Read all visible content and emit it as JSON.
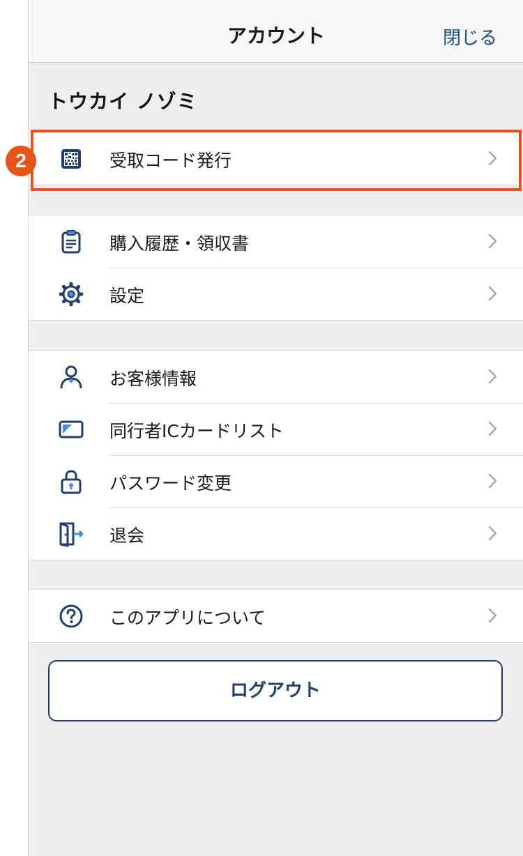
{
  "header": {
    "title": "アカウント",
    "close_label": "閉じる"
  },
  "user": {
    "name": "トウカイ ノゾミ"
  },
  "step_badge": "2",
  "groups": [
    {
      "items": [
        {
          "label": "受取コード発行",
          "icon": "qr-code-icon"
        }
      ]
    },
    {
      "items": [
        {
          "label": "購入履歴・領収書",
          "icon": "clipboard-icon"
        },
        {
          "label": "設定",
          "icon": "gear-icon"
        }
      ]
    },
    {
      "items": [
        {
          "label": "お客様情報",
          "icon": "person-icon"
        },
        {
          "label": "同行者ICカードリスト",
          "icon": "ic-card-icon"
        },
        {
          "label": "パスワード変更",
          "icon": "lock-icon"
        },
        {
          "label": "退会",
          "icon": "exit-door-icon"
        }
      ]
    },
    {
      "items": [
        {
          "label": "このアプリについて",
          "icon": "question-icon"
        }
      ]
    }
  ],
  "logout_label": "ログアウト",
  "colors": {
    "accent_navy": "#1f3f6e",
    "link_blue": "#1f4e8c",
    "highlight_orange": "#e8521b",
    "icon_light_blue": "#4a90d9"
  }
}
